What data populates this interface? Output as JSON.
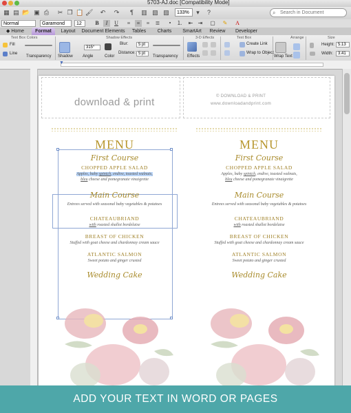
{
  "window": {
    "title": "5703-AJ.doc [Compatibility Mode]",
    "zoom": "133%",
    "search_placeholder": "Search in Document"
  },
  "format_bar": {
    "style": "Normal",
    "font": "Garamond",
    "size": "12",
    "bold": "B",
    "italic": "I",
    "underline": "U"
  },
  "tabs": [
    {
      "label": "Home",
      "active": false
    },
    {
      "label": "Format",
      "active": true
    },
    {
      "label": "Layout",
      "active": false
    },
    {
      "label": "Document Elements",
      "active": false
    },
    {
      "label": "Tables",
      "active": false
    },
    {
      "label": "Charts",
      "active": false
    },
    {
      "label": "SmartArt",
      "active": false
    },
    {
      "label": "Review",
      "active": false
    },
    {
      "label": "Developer",
      "active": false
    }
  ],
  "ribbon": {
    "groups": {
      "text_box_colors": "Text Box Colors",
      "shadow_effects": "Shadow Effects",
      "threed_effects": "3-D Effects",
      "text_box": "Text Box",
      "arrange": "Arrange",
      "size": "Size"
    },
    "fill": "Fill",
    "line": "Line",
    "transparency": "Transparency",
    "shadow": "Shadow",
    "angle": "Angle",
    "angle_value": "315°",
    "color": "Color",
    "blur": "Blur:",
    "blur_value": "5 pt",
    "distance": "Distance:",
    "distance_value": "5 pt",
    "shadow_transparency": "Transparency",
    "effects": "Effects",
    "create_link": "Create Link",
    "wrap_to_object": "Wrap to Object",
    "wrap_text": "Wrap Text",
    "height_label": "Height:",
    "height_value": "5.13",
    "width_label": "Width:",
    "width_value": "3.41"
  },
  "document": {
    "logo": "download & print",
    "copyright": "© DOWNLOAD & PRINT",
    "website": "www.downloadandprint.com",
    "menu": {
      "title": "MENU",
      "first_course": "First Course",
      "item1": "CHOPPED APPLE SALAD",
      "item1_desc_a": "Apples, baby",
      "item1_desc_spinach": "spinich",
      "item1_desc_b": ", endive, toasted walnuts,",
      "item1_desc_bleu": "bleu",
      "item1_desc_c": " cheese and pomegranate vinaigrette",
      "main_course": "Main Course",
      "main_desc": "Entrees served with seasonal baby vegetables & potatoes",
      "item2": "CHATEAUBRIAND",
      "item2_desc_with": "with",
      "item2_desc": " roasted shallot bordelaise",
      "item3": "BREAST OF CHICKEN",
      "item3_desc": "Stuffed with goat cheese and chardonnay cream sauce",
      "item4": "ATLANTIC SALMON",
      "item4_desc": "Sweet potato and ginger crusted",
      "dessert": "Wedding Cake"
    }
  },
  "banner": {
    "text": "ADD YOUR TEXT IN WORD OR PAGES"
  },
  "colors": {
    "gold": "#b8972f",
    "banner": "#4ea7a9",
    "active_tab": "#c2a6e0"
  }
}
